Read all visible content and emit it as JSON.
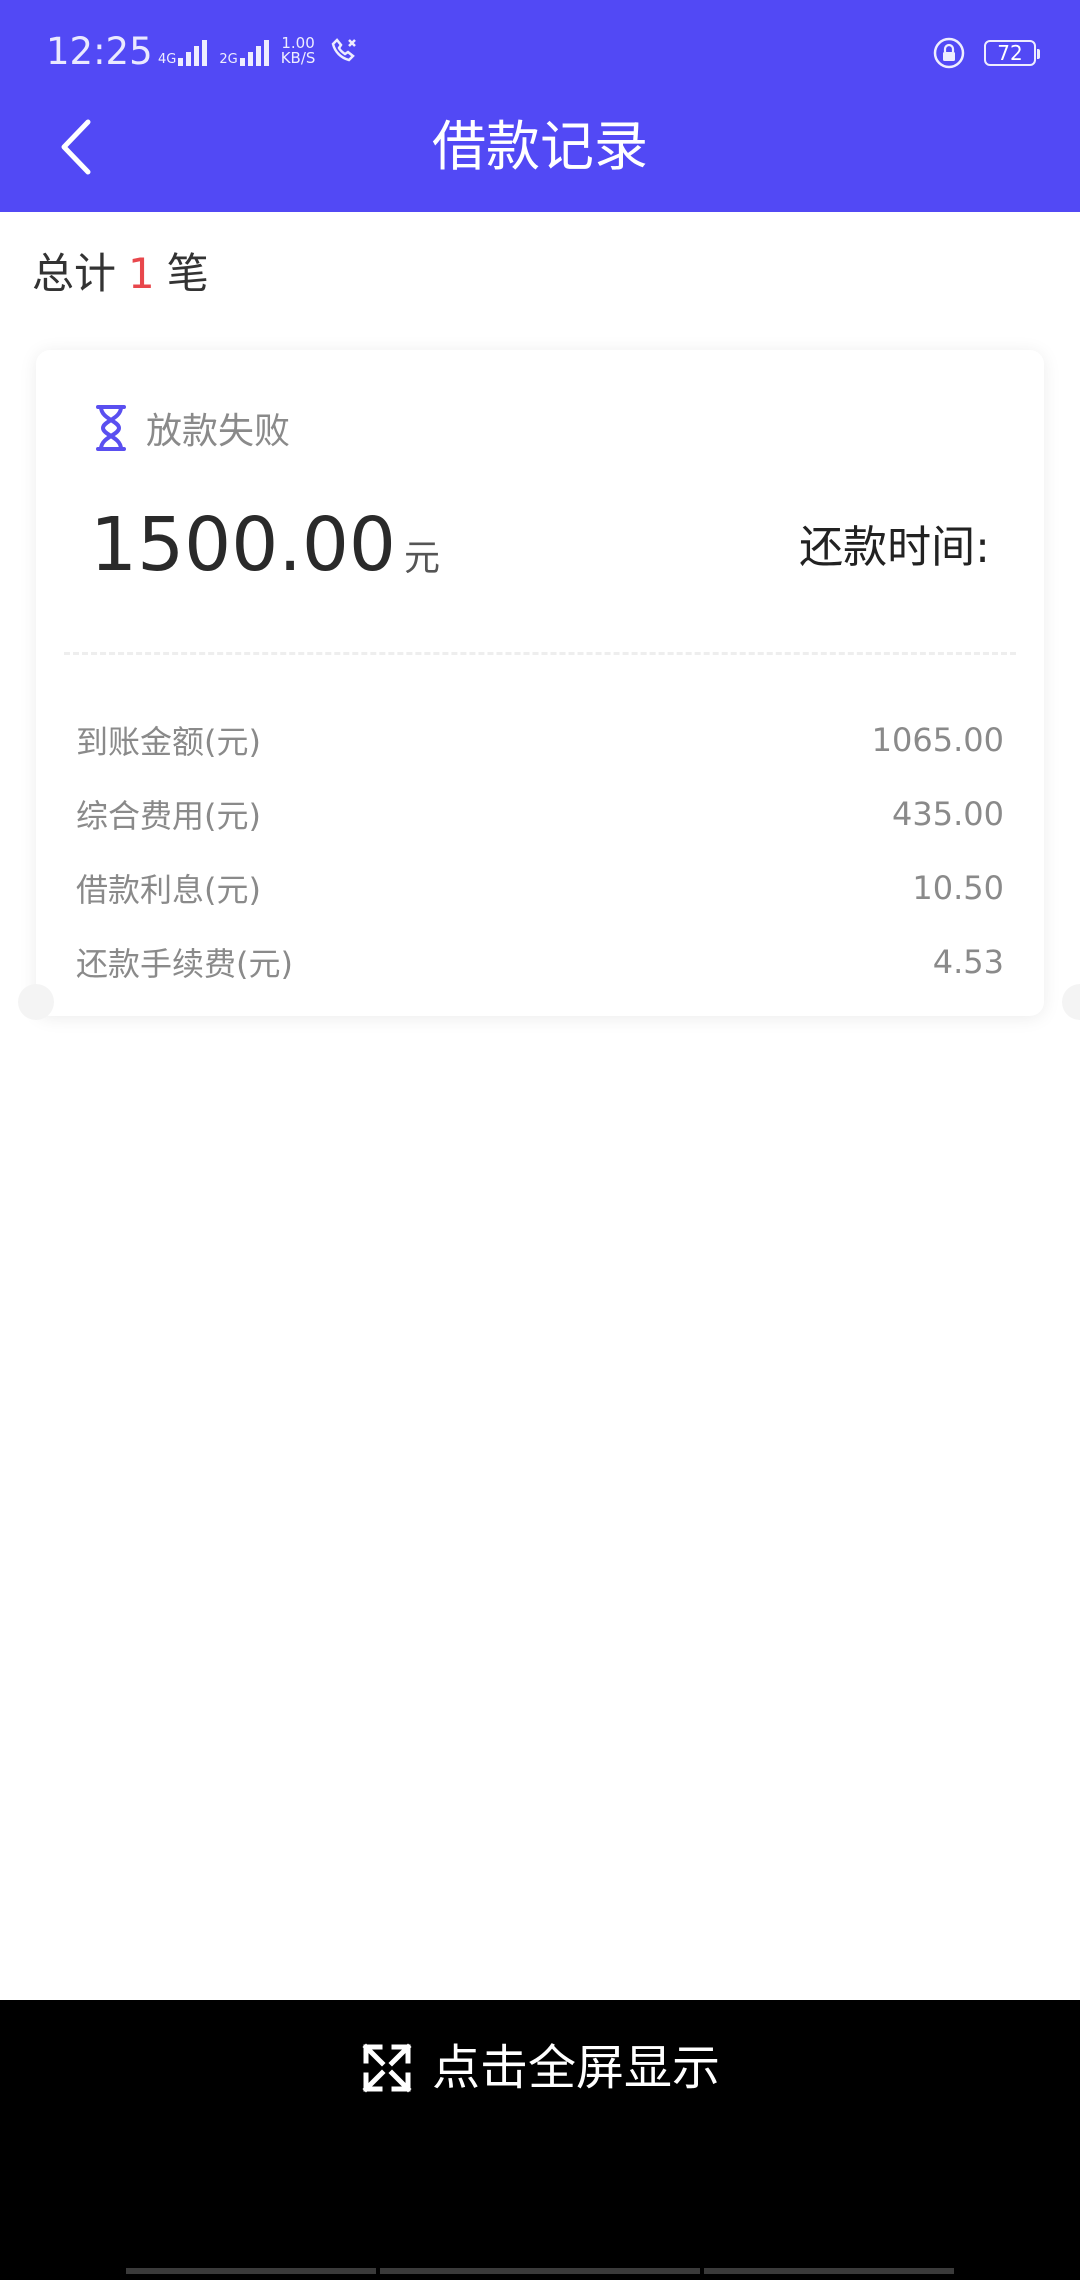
{
  "status_bar": {
    "time": "12:25",
    "network_4g": "4G",
    "network_2g": "2G",
    "speed_value": "1.00",
    "speed_unit": "KB/S",
    "battery": "72"
  },
  "header": {
    "title": "借款记录"
  },
  "summary": {
    "prefix": "总计",
    "count": "1",
    "suffix": "笔"
  },
  "record": {
    "status": "放款失败",
    "amount": "1500.00",
    "amount_unit": "元",
    "repay_time_label": "还款时间:",
    "details": [
      {
        "label": "到账金额(元)",
        "value": "1065.00"
      },
      {
        "label": "综合费用(元)",
        "value": "435.00"
      },
      {
        "label": "借款利息(元)",
        "value": "10.50"
      },
      {
        "label": "还款手续费(元)",
        "value": "4.53"
      }
    ]
  },
  "overlay": {
    "fullscreen_label": "点击全屏显示"
  },
  "colors": {
    "header_bg": "#5249F5",
    "highlight_red": "#E8474C",
    "status_icon": "#5A4FF0"
  }
}
